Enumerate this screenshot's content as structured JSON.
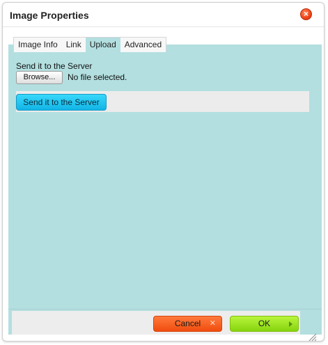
{
  "dialog": {
    "title": "Image Properties",
    "close_icon": "close-icon"
  },
  "tabs": [
    {
      "label": "Image Info",
      "active": false
    },
    {
      "label": "Link",
      "active": false
    },
    {
      "label": "Upload",
      "active": true
    },
    {
      "label": "Advanced",
      "active": false
    }
  ],
  "upload": {
    "section_label": "Send it to the Server",
    "browse_label": "Browse...",
    "file_status": "No file selected.",
    "send_button_label": "Send it to the Server"
  },
  "footer": {
    "cancel_label": "Cancel",
    "ok_label": "OK"
  },
  "colors": {
    "panel_background": "#b3dfe0",
    "cancel_button": "#f04d0e",
    "ok_button": "#86d40f",
    "send_button": "#12b4e6",
    "close_button": "#f2471b"
  }
}
